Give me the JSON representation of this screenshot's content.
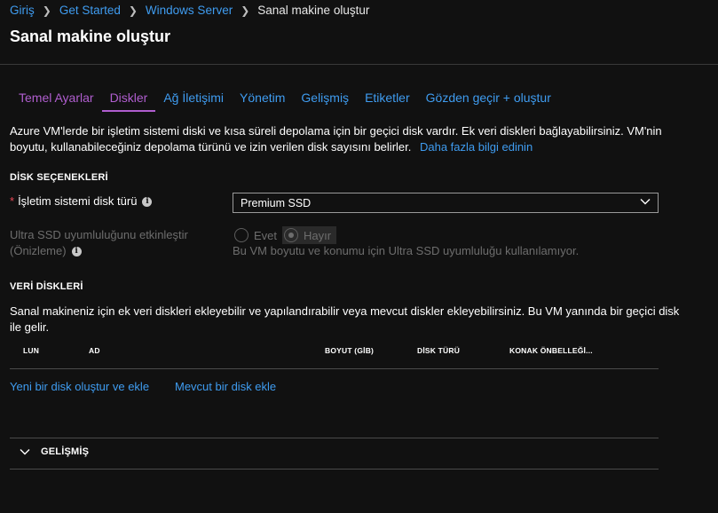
{
  "breadcrumb": {
    "items": [
      "Giriş",
      "Get Started",
      "Windows Server"
    ],
    "current": "Sanal makine oluştur"
  },
  "page_title": "Sanal makine oluştur",
  "tabs": [
    {
      "label": "Temel Ayarlar",
      "state": "visited"
    },
    {
      "label": "Diskler",
      "state": "active"
    },
    {
      "label": "Ağ İletişimi",
      "state": "normal"
    },
    {
      "label": "Yönetim",
      "state": "normal"
    },
    {
      "label": "Gelişmiş",
      "state": "normal"
    },
    {
      "label": "Etiketler",
      "state": "normal"
    },
    {
      "label": "Gözden geçir + oluştur",
      "state": "normal"
    }
  ],
  "intro": {
    "text": "Azure VM'lerde bir işletim sistemi diski ve kısa süreli depolama için bir geçici disk vardır. Ek veri diskleri bağlayabilirsiniz. VM'nin boyutu, kullanabileceğiniz depolama türünü ve izin verilen disk sayısını belirler.",
    "link": "Daha fazla bilgi edinin"
  },
  "disk_options": {
    "heading": "DİSK SEÇENEKLERİ",
    "os_disk_label": "İşletim sistemi disk türü",
    "os_disk_value": "Premium SSD",
    "ultra_label_line1": "Ultra SSD uyumluluğunu etkinleştir",
    "ultra_label_line2": "(Önizleme)",
    "ultra_yes": "Evet",
    "ultra_no": "Hayır",
    "ultra_selected": "Hayır",
    "ultra_note": "Bu VM boyutu ve konumu için Ultra SSD uyumluluğu kullanılamıyor."
  },
  "data_disks": {
    "heading": "VERİ DİSKLERİ",
    "description": "Sanal makineniz için ek veri diskleri ekleyebilir ve yapılandırabilir veya mevcut diskler ekleyebilirsiniz. Bu VM yanında bir geçici disk ile gelir.",
    "columns": [
      "LUN",
      "AD",
      "BOYUT (GİB)",
      "DİSK TÜRÜ",
      "KONAK ÖNBELLEĞİ..."
    ],
    "rows": [],
    "create_link": "Yeni bir disk oluştur ve ekle",
    "attach_link": "Mevcut bir disk ekle"
  },
  "advanced": {
    "label": "GELİŞMİŞ",
    "expanded": false
  },
  "colors": {
    "background": "#111111",
    "link": "#3f9cf0",
    "tab_active": "#b05ecf",
    "required": "#e74856",
    "disabled": "#6d6d6d"
  }
}
